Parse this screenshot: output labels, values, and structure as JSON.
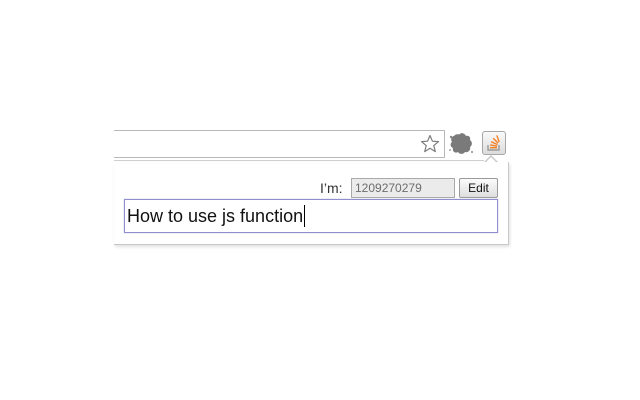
{
  "toolbar": {
    "icons": {
      "bookmark": "star-icon",
      "extension_1": "splat-icon",
      "extension_2": "stack-overflow-icon"
    }
  },
  "popup": {
    "user_label": "I’m:",
    "user_id_value": "1209270279",
    "edit_label": "Edit",
    "query_text": "How to use js function"
  },
  "colors": {
    "query_border": "#8f8fcf",
    "so_orange": "#f48024",
    "splat_gray": "#7a7a7a"
  }
}
